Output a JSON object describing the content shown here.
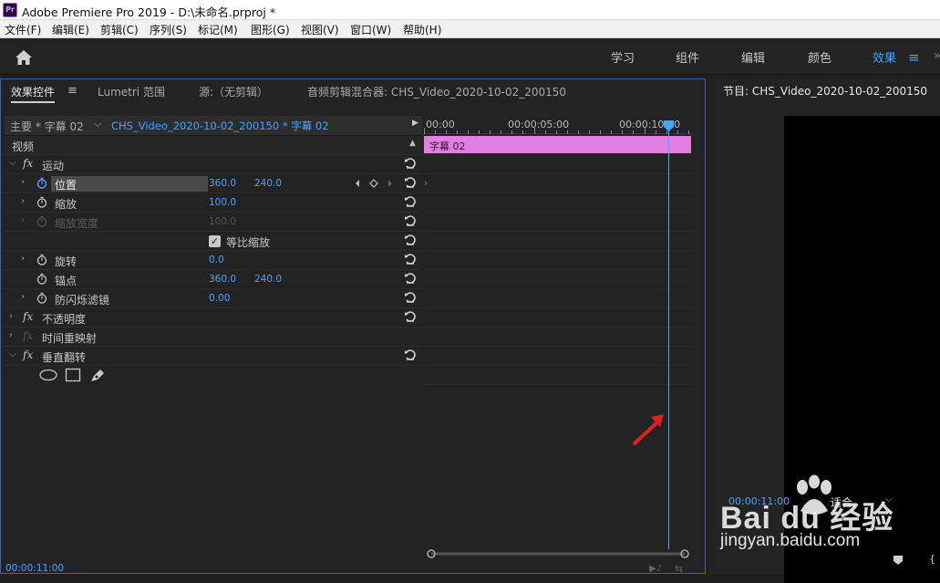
{
  "window": {
    "app_icon": "Pr",
    "title": "Adobe Premiere Pro 2019 - D:\\未命名.prproj *"
  },
  "menu": [
    "文件(F)",
    "编辑(E)",
    "剪辑(C)",
    "序列(S)",
    "标记(M)",
    "图形(G)",
    "视图(V)",
    "窗口(W)",
    "帮助(H)"
  ],
  "workspace_tabs": [
    "学习",
    "组件",
    "编辑",
    "颜色",
    "效果"
  ],
  "workspace_active": "效果",
  "workspace_menu_glyph": "≡",
  "panel_tabs": {
    "effects": "效果控件",
    "menu_glyph": "≡",
    "lumetri": "Lumetri 范围",
    "source": "源:（无剪辑）",
    "audio_mixer": "音频剪辑混合器: CHS_Video_2020-10-02_200150"
  },
  "effect_controls": {
    "master": "主要 * 字幕 02",
    "clip": "CHS_Video_2020-10-02_200150 * 字幕 02",
    "section_video": "视频",
    "motion": "运动",
    "position": {
      "label": "位置",
      "x": "360.0",
      "y": "240.0"
    },
    "scale": {
      "label": "缩放",
      "value": "100.0"
    },
    "scale_width": {
      "label": "缩放宽度",
      "value": "100.0"
    },
    "uniform_scale": "等比缩放",
    "rotation": {
      "label": "旋转",
      "value": "0.0"
    },
    "anchor": {
      "label": "锚点",
      "x": "360.0",
      "y": "240.0"
    },
    "anti_flicker": {
      "label": "防闪烁滤镜",
      "value": "0.00"
    },
    "opacity": "不透明度",
    "time_remap": "时间重映射",
    "vertical_flip": "垂直翻转",
    "current_time": "00:00:11:00"
  },
  "timeline": {
    "times": [
      "00:00",
      "00:00:05:00",
      "00:00:10:00"
    ],
    "clip_label": "字幕 02",
    "clip_color": "#e080e0"
  },
  "program": {
    "title": "节目: CHS_Video_2020-10-02_200150",
    "timecode": "00:00:11:00",
    "fit": "适合"
  },
  "watermark": {
    "brand": "Bai du 经验",
    "url": "jingyan.baidu.com"
  },
  "colors": {
    "accent": "#4aa3ff",
    "arrow": "#e02020"
  }
}
